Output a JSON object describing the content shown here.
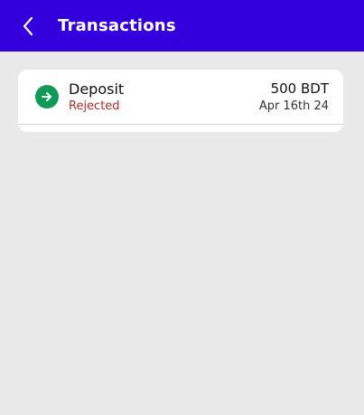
{
  "header": {
    "title": "Transactions",
    "back_icon": "chevron-left-icon",
    "background_color": "#3300dd"
  },
  "transactions": [
    {
      "type": "Deposit",
      "status": "Rejected",
      "amount": "500 BDT",
      "date": "Apr 16th 24",
      "icon": "arrow-right-icon",
      "icon_color": "#0f9a56",
      "status_color": "#b52b2b"
    }
  ]
}
